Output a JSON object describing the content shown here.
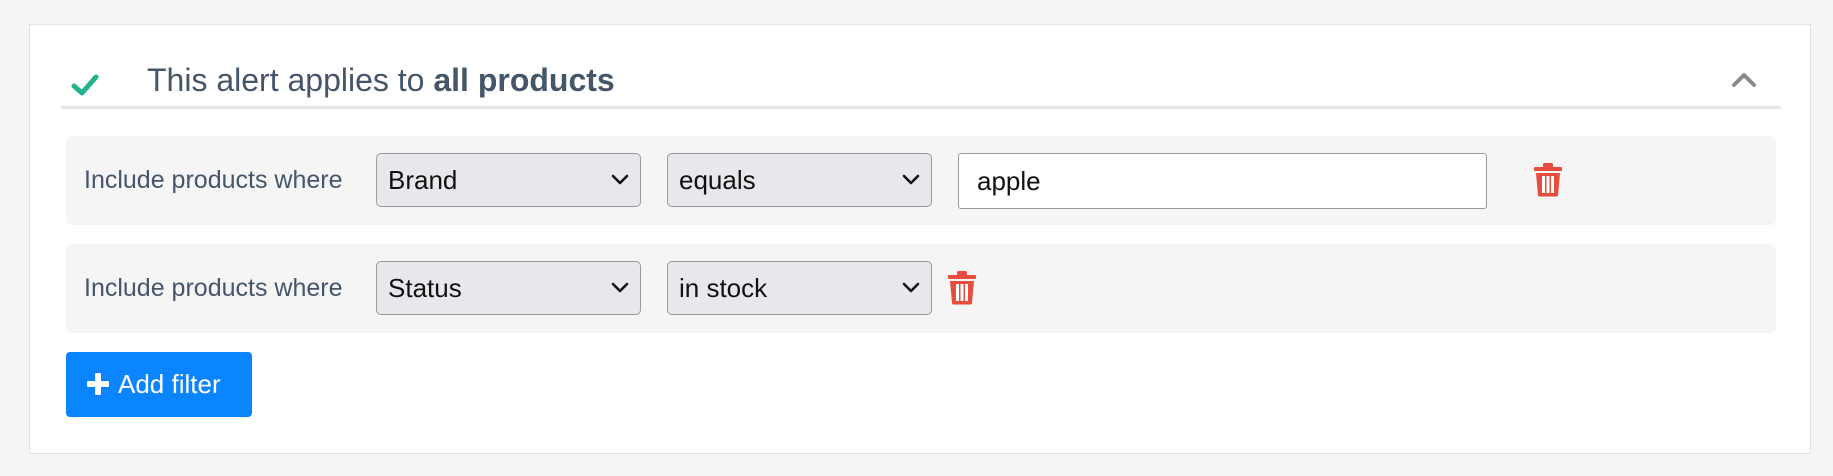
{
  "colors": {
    "accent_check": "#23b38f",
    "title_text": "#45556a",
    "danger": "#e74c3c",
    "primary_button": "#0a84ff"
  },
  "header": {
    "title_prefix": "This alert applies to ",
    "title_bold": "all products",
    "status_icon": "check-icon",
    "collapse_icon": "chevron-up-icon"
  },
  "filters": [
    {
      "label": "Include products where",
      "field": "Brand",
      "operator": "equals",
      "value": "apple",
      "delete_icon": "trash-icon"
    },
    {
      "label": "Include products where",
      "field": "Status",
      "operator": "in stock",
      "delete_icon": "trash-icon"
    }
  ],
  "add_button": {
    "label": "Add filter",
    "icon": "plus-icon"
  }
}
